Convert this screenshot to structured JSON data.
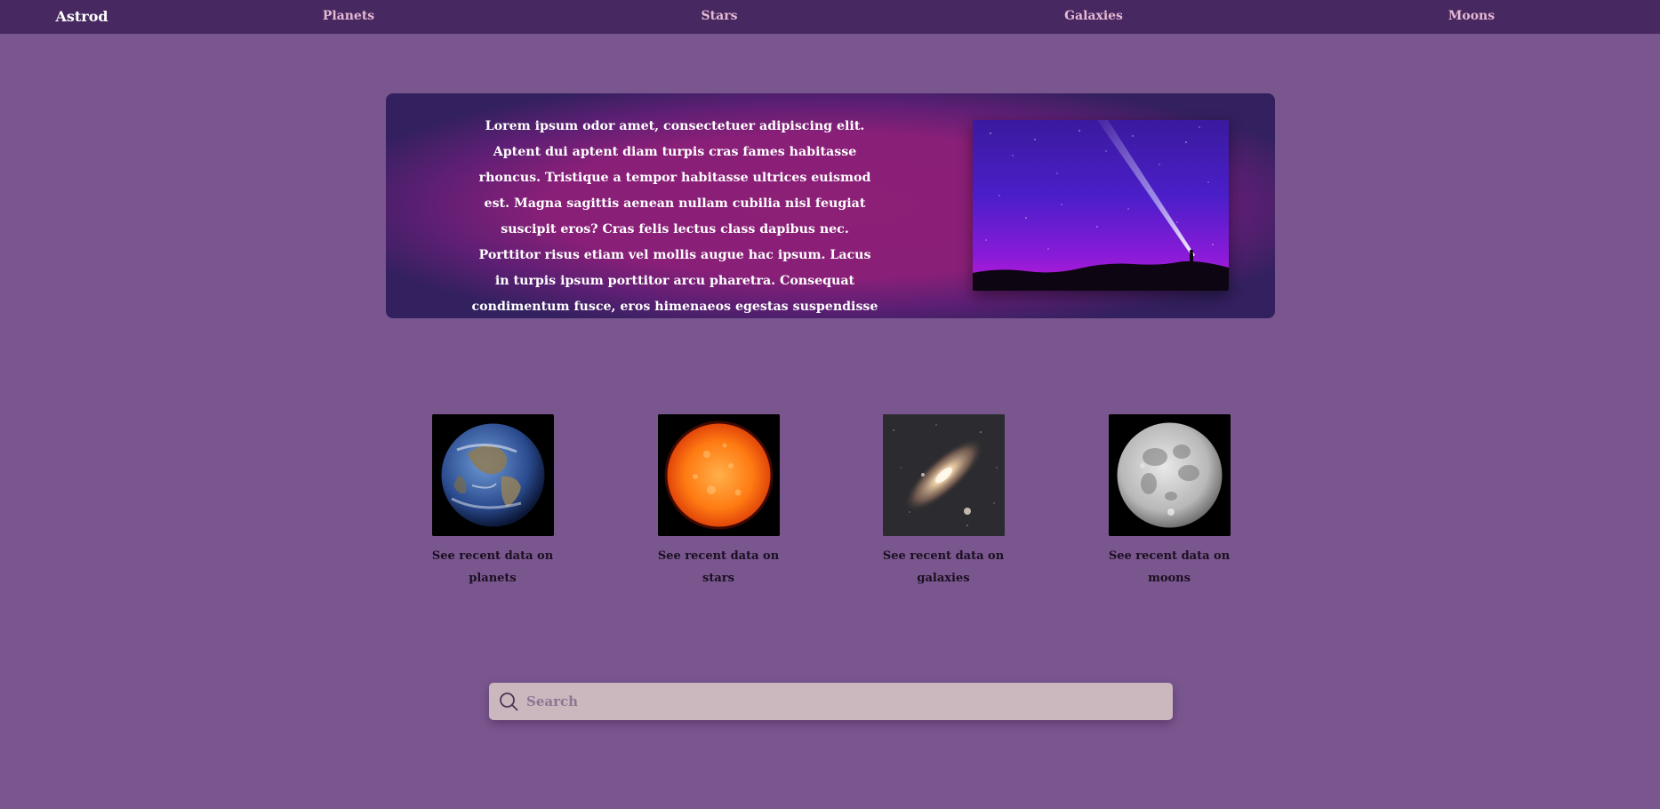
{
  "nav": {
    "brand": "Astrod",
    "items": [
      "Planets",
      "Stars",
      "Galaxies",
      "Moons"
    ]
  },
  "hero": {
    "text": "Lorem ipsum odor amet, consectetuer adipiscing elit. Aptent dui aptent diam turpis cras fames habitasse rhoncus. Tristique a tempor habitasse ultrices euismod est. Magna sagittis aenean nullam cubilia nisl feugiat suscipit eros? Cras felis lectus class dapibus nec. Porttitor risus etiam vel mollis augue hac ipsum. Lacus in turpis ipsum porttitor arcu pharetra. Consequat condimentum fusce, eros himenaeos egestas suspendisse odio hendrerit."
  },
  "cards": [
    {
      "caption": "See recent data on planets",
      "image": "earth"
    },
    {
      "caption": "See recent data on stars",
      "image": "sun"
    },
    {
      "caption": "See recent data on galaxies",
      "image": "galaxy"
    },
    {
      "caption": "See recent data on moons",
      "image": "moon"
    }
  ],
  "search": {
    "placeholder": "Search",
    "value": ""
  },
  "colors": {
    "background": "#7a568f",
    "nav": "#472860",
    "nav_link": "#e4b9d3",
    "hero_center": "#8c1f76",
    "search_bg": "#cbb8bf"
  }
}
